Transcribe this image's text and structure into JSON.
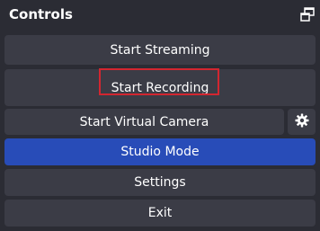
{
  "dock": {
    "title": "Controls",
    "undock_icon": "undock-icon"
  },
  "controls": {
    "start_streaming_label": "Start Streaming",
    "start_recording_label": "Start Recording",
    "start_virtual_camera_label": "Start Virtual Camera",
    "virtual_camera_settings_icon": "gear-icon",
    "studio_mode_label": "Studio Mode",
    "settings_label": "Settings",
    "exit_label": "Exit"
  },
  "state": {
    "studio_mode_active": true,
    "highlighted_control": "Start Recording"
  },
  "colors": {
    "panel_bg": "#2b2c34",
    "button_bg": "#3b3c46",
    "active_button_bg": "#284cb8",
    "highlight_border": "#d32630",
    "text": "#ffffff"
  }
}
